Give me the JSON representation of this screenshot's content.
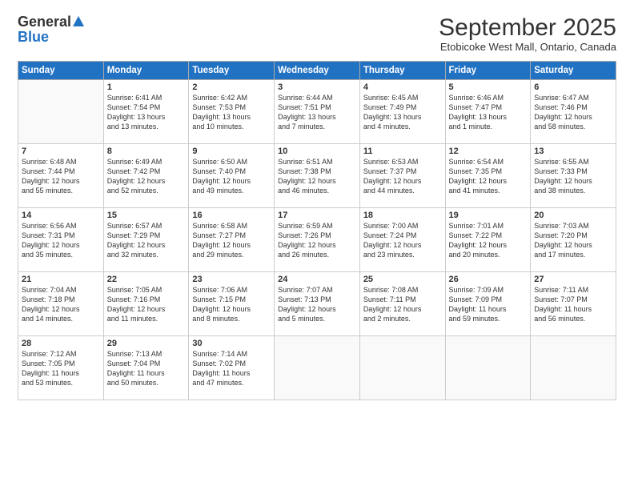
{
  "logo": {
    "general": "General",
    "blue": "Blue"
  },
  "header": {
    "month": "September 2025",
    "location": "Etobicoke West Mall, Ontario, Canada"
  },
  "weekdays": [
    "Sunday",
    "Monday",
    "Tuesday",
    "Wednesday",
    "Thursday",
    "Friday",
    "Saturday"
  ],
  "weeks": [
    [
      {
        "day": "",
        "info": ""
      },
      {
        "day": "1",
        "info": "Sunrise: 6:41 AM\nSunset: 7:54 PM\nDaylight: 13 hours\nand 13 minutes."
      },
      {
        "day": "2",
        "info": "Sunrise: 6:42 AM\nSunset: 7:53 PM\nDaylight: 13 hours\nand 10 minutes."
      },
      {
        "day": "3",
        "info": "Sunrise: 6:44 AM\nSunset: 7:51 PM\nDaylight: 13 hours\nand 7 minutes."
      },
      {
        "day": "4",
        "info": "Sunrise: 6:45 AM\nSunset: 7:49 PM\nDaylight: 13 hours\nand 4 minutes."
      },
      {
        "day": "5",
        "info": "Sunrise: 6:46 AM\nSunset: 7:47 PM\nDaylight: 13 hours\nand 1 minute."
      },
      {
        "day": "6",
        "info": "Sunrise: 6:47 AM\nSunset: 7:46 PM\nDaylight: 12 hours\nand 58 minutes."
      }
    ],
    [
      {
        "day": "7",
        "info": "Sunrise: 6:48 AM\nSunset: 7:44 PM\nDaylight: 12 hours\nand 55 minutes."
      },
      {
        "day": "8",
        "info": "Sunrise: 6:49 AM\nSunset: 7:42 PM\nDaylight: 12 hours\nand 52 minutes."
      },
      {
        "day": "9",
        "info": "Sunrise: 6:50 AM\nSunset: 7:40 PM\nDaylight: 12 hours\nand 49 minutes."
      },
      {
        "day": "10",
        "info": "Sunrise: 6:51 AM\nSunset: 7:38 PM\nDaylight: 12 hours\nand 46 minutes."
      },
      {
        "day": "11",
        "info": "Sunrise: 6:53 AM\nSunset: 7:37 PM\nDaylight: 12 hours\nand 44 minutes."
      },
      {
        "day": "12",
        "info": "Sunrise: 6:54 AM\nSunset: 7:35 PM\nDaylight: 12 hours\nand 41 minutes."
      },
      {
        "day": "13",
        "info": "Sunrise: 6:55 AM\nSunset: 7:33 PM\nDaylight: 12 hours\nand 38 minutes."
      }
    ],
    [
      {
        "day": "14",
        "info": "Sunrise: 6:56 AM\nSunset: 7:31 PM\nDaylight: 12 hours\nand 35 minutes."
      },
      {
        "day": "15",
        "info": "Sunrise: 6:57 AM\nSunset: 7:29 PM\nDaylight: 12 hours\nand 32 minutes."
      },
      {
        "day": "16",
        "info": "Sunrise: 6:58 AM\nSunset: 7:27 PM\nDaylight: 12 hours\nand 29 minutes."
      },
      {
        "day": "17",
        "info": "Sunrise: 6:59 AM\nSunset: 7:26 PM\nDaylight: 12 hours\nand 26 minutes."
      },
      {
        "day": "18",
        "info": "Sunrise: 7:00 AM\nSunset: 7:24 PM\nDaylight: 12 hours\nand 23 minutes."
      },
      {
        "day": "19",
        "info": "Sunrise: 7:01 AM\nSunset: 7:22 PM\nDaylight: 12 hours\nand 20 minutes."
      },
      {
        "day": "20",
        "info": "Sunrise: 7:03 AM\nSunset: 7:20 PM\nDaylight: 12 hours\nand 17 minutes."
      }
    ],
    [
      {
        "day": "21",
        "info": "Sunrise: 7:04 AM\nSunset: 7:18 PM\nDaylight: 12 hours\nand 14 minutes."
      },
      {
        "day": "22",
        "info": "Sunrise: 7:05 AM\nSunset: 7:16 PM\nDaylight: 12 hours\nand 11 minutes."
      },
      {
        "day": "23",
        "info": "Sunrise: 7:06 AM\nSunset: 7:15 PM\nDaylight: 12 hours\nand 8 minutes."
      },
      {
        "day": "24",
        "info": "Sunrise: 7:07 AM\nSunset: 7:13 PM\nDaylight: 12 hours\nand 5 minutes."
      },
      {
        "day": "25",
        "info": "Sunrise: 7:08 AM\nSunset: 7:11 PM\nDaylight: 12 hours\nand 2 minutes."
      },
      {
        "day": "26",
        "info": "Sunrise: 7:09 AM\nSunset: 7:09 PM\nDaylight: 11 hours\nand 59 minutes."
      },
      {
        "day": "27",
        "info": "Sunrise: 7:11 AM\nSunset: 7:07 PM\nDaylight: 11 hours\nand 56 minutes."
      }
    ],
    [
      {
        "day": "28",
        "info": "Sunrise: 7:12 AM\nSunset: 7:05 PM\nDaylight: 11 hours\nand 53 minutes."
      },
      {
        "day": "29",
        "info": "Sunrise: 7:13 AM\nSunset: 7:04 PM\nDaylight: 11 hours\nand 50 minutes."
      },
      {
        "day": "30",
        "info": "Sunrise: 7:14 AM\nSunset: 7:02 PM\nDaylight: 11 hours\nand 47 minutes."
      },
      {
        "day": "",
        "info": ""
      },
      {
        "day": "",
        "info": ""
      },
      {
        "day": "",
        "info": ""
      },
      {
        "day": "",
        "info": ""
      }
    ]
  ]
}
